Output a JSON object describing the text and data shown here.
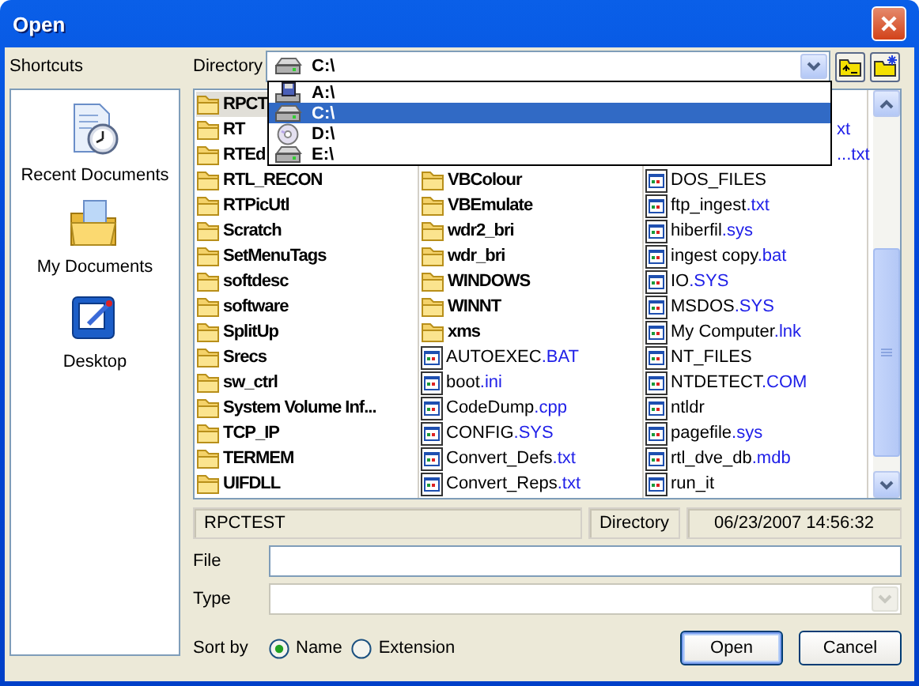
{
  "window": {
    "title": "Open"
  },
  "shortcuts": {
    "label": "Shortcuts",
    "items": [
      {
        "label": "Recent Documents",
        "kind": "recent"
      },
      {
        "label": "My Documents",
        "kind": "documents"
      },
      {
        "label": "Desktop",
        "kind": "desktop"
      }
    ]
  },
  "directory": {
    "label": "Directory",
    "value": "C:\\",
    "options": [
      {
        "label": "A:\\",
        "kind": "floppy",
        "selected": false
      },
      {
        "label": "C:\\",
        "kind": "hdd",
        "selected": true
      },
      {
        "label": "D:\\",
        "kind": "cd",
        "selected": false
      },
      {
        "label": "E:\\",
        "kind": "hdd",
        "selected": false
      }
    ]
  },
  "file_list": {
    "columns": [
      [
        {
          "name": "RPCT",
          "kind": "folder",
          "selected": true
        },
        {
          "name": "RT",
          "kind": "folder",
          "selected": false
        },
        {
          "name": "RTEd",
          "kind": "folder",
          "selected": false
        },
        {
          "name": "RTL_RECON",
          "kind": "folder",
          "selected": false
        },
        {
          "name": "RTPicUtl",
          "kind": "folder",
          "selected": false
        },
        {
          "name": "Scratch",
          "kind": "folder",
          "selected": false
        },
        {
          "name": "SetMenuTags",
          "kind": "folder",
          "selected": false
        },
        {
          "name": "softdesc",
          "kind": "folder",
          "selected": false
        },
        {
          "name": "software",
          "kind": "folder",
          "selected": false
        },
        {
          "name": "SplitUp",
          "kind": "folder",
          "selected": false
        },
        {
          "name": "Srecs",
          "kind": "folder",
          "selected": false
        },
        {
          "name": "sw_ctrl",
          "kind": "folder",
          "selected": false
        },
        {
          "name": "System Volume Inf...",
          "kind": "folder",
          "selected": false
        },
        {
          "name": "TCP_IP",
          "kind": "folder",
          "selected": false
        },
        {
          "name": "TERMEM",
          "kind": "folder",
          "selected": false
        },
        {
          "name": "UIFDLL",
          "kind": "folder",
          "selected": false
        }
      ],
      [
        {
          "name": "VBColour",
          "kind": "folder",
          "selected": false
        },
        {
          "name": "VBEmulate",
          "kind": "folder",
          "selected": false
        },
        {
          "name": "wdr2_bri",
          "kind": "folder",
          "selected": false
        },
        {
          "name": "wdr_bri",
          "kind": "folder",
          "selected": false
        },
        {
          "name": "WINDOWS",
          "kind": "folder",
          "selected": false
        },
        {
          "name": "WINNT",
          "kind": "folder",
          "selected": false
        },
        {
          "name": "xms",
          "kind": "folder",
          "selected": false
        },
        {
          "name": "AUTOEXEC",
          "ext": ".BAT",
          "kind": "file",
          "selected": false
        },
        {
          "name": "boot",
          "ext": ".ini",
          "kind": "file",
          "selected": false
        },
        {
          "name": "CodeDump",
          "ext": ".cpp",
          "kind": "file",
          "selected": false
        },
        {
          "name": "CONFIG",
          "ext": ".SYS",
          "kind": "file",
          "selected": false
        },
        {
          "name": "Convert_Defs",
          "ext": ".txt",
          "kind": "file",
          "selected": false
        },
        {
          "name": "Convert_Reps",
          "ext": ".txt",
          "kind": "file",
          "selected": false
        }
      ],
      [
        {
          "ext": "xt",
          "kind": "covered",
          "selected": false
        },
        {
          "ext": "...txt",
          "kind": "covered",
          "selected": false
        },
        {
          "name": "DOS_FILES",
          "kind": "file",
          "selected": false
        },
        {
          "name": "ftp_ingest",
          "ext": ".txt",
          "kind": "file",
          "selected": false
        },
        {
          "name": "hiberfil",
          "ext": ".sys",
          "kind": "file",
          "selected": false
        },
        {
          "name": "ingest copy",
          "ext": ".bat",
          "kind": "file",
          "selected": false
        },
        {
          "name": "IO",
          "ext": ".SYS",
          "kind": "file",
          "selected": false
        },
        {
          "name": "MSDOS",
          "ext": ".SYS",
          "kind": "file",
          "selected": false
        },
        {
          "name": "My Computer",
          "ext": ".lnk",
          "kind": "file",
          "selected": false
        },
        {
          "name": "NT_FILES",
          "kind": "file",
          "selected": false
        },
        {
          "name": "NTDETECT",
          "ext": ".COM",
          "kind": "file",
          "selected": false
        },
        {
          "name": "ntldr",
          "kind": "file",
          "selected": false
        },
        {
          "name": "pagefile",
          "ext": ".sys",
          "kind": "file",
          "selected": false
        },
        {
          "name": "rtl_dve_db",
          "ext": ".mdb",
          "kind": "file",
          "selected": false
        },
        {
          "name": "run_it",
          "kind": "file",
          "selected": false
        }
      ]
    ]
  },
  "status_bar": {
    "name": "RPCTEST",
    "type": "Directory",
    "modified": "06/23/2007 14:56:32"
  },
  "file_field": {
    "label": "File"
  },
  "type_field": {
    "label": "Type",
    "disabled": true
  },
  "sort_by": {
    "label": "Sort by",
    "options": [
      {
        "label": "Name",
        "selected": true
      },
      {
        "label": "Extension",
        "selected": false
      }
    ]
  },
  "buttons": [
    {
      "label": "Open",
      "default": true
    },
    {
      "label": "Cancel",
      "default": false
    }
  ]
}
